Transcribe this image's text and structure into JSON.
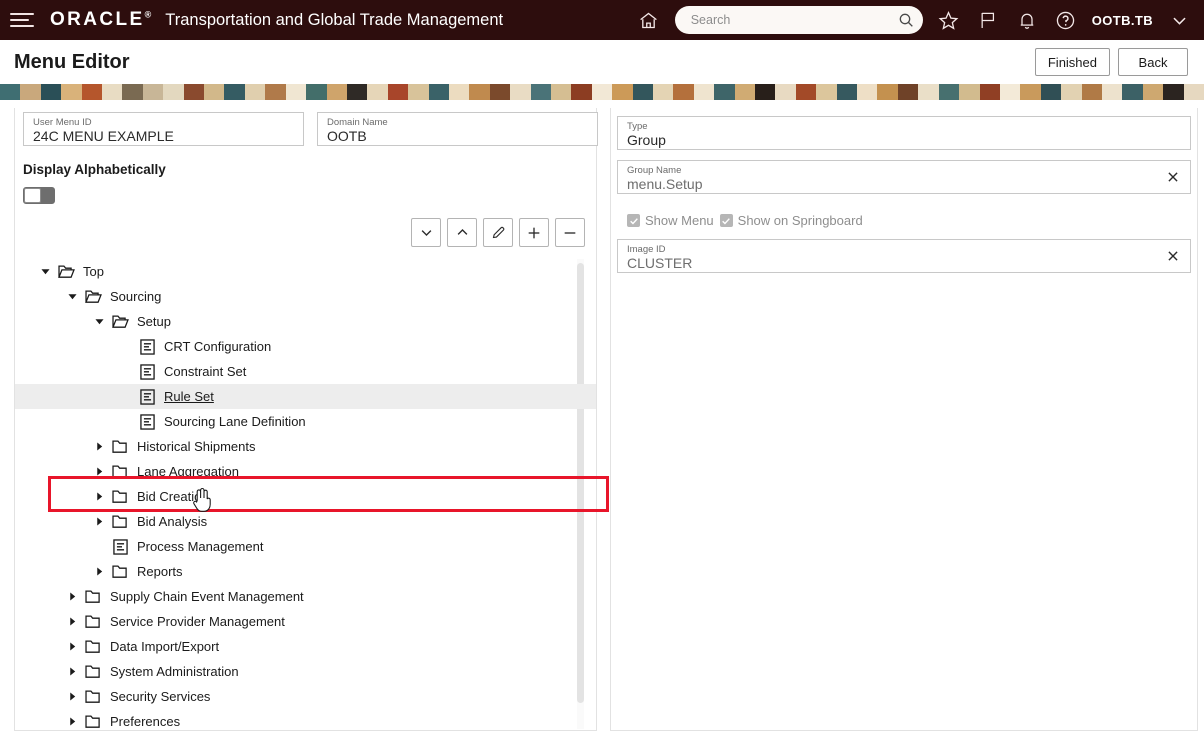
{
  "header": {
    "menu_icon": "hamburger-icon",
    "brand": "ORACLE",
    "brand_trademark": "®",
    "app_title": "Transportation and Global Trade Management",
    "home_icon": "home-icon",
    "search": {
      "value": "",
      "placeholder": "Search",
      "icon": "search-icon"
    },
    "icons": [
      "star-icon",
      "flag-icon",
      "bell-icon",
      "help-icon"
    ],
    "user": "OOTB.TB",
    "user_chevron": "chevron-down-icon"
  },
  "page": {
    "title": "Menu Editor",
    "actions": [
      {
        "label": "Finished",
        "name": "finished-button"
      },
      {
        "label": "Back",
        "name": "back-button"
      }
    ]
  },
  "left": {
    "user_menu_id": {
      "label": "User Menu ID",
      "value": "24C MENU EXAMPLE"
    },
    "domain_name": {
      "label": "Domain Name",
      "value": "OOTB"
    },
    "display_alphabetically_label": "Display Alphabetically",
    "display_alphabetically_on": false,
    "toolbar": [
      {
        "name": "move-down-button",
        "icon": "chevron-down-icon"
      },
      {
        "name": "move-up-button",
        "icon": "chevron-up-icon"
      },
      {
        "name": "edit-button",
        "icon": "pencil-icon"
      },
      {
        "name": "add-button",
        "icon": "plus-icon"
      },
      {
        "name": "remove-button",
        "icon": "minus-icon"
      }
    ],
    "tree": [
      {
        "label": "Top",
        "depth": 0,
        "kind": "folder",
        "state": "expanded"
      },
      {
        "label": "Sourcing",
        "depth": 1,
        "kind": "folder",
        "state": "expanded"
      },
      {
        "label": "Setup",
        "depth": 2,
        "kind": "folder",
        "state": "expanded"
      },
      {
        "label": "CRT Configuration",
        "depth": 3,
        "kind": "page",
        "state": "leaf"
      },
      {
        "label": "Constraint Set",
        "depth": 3,
        "kind": "page",
        "state": "leaf"
      },
      {
        "label": "Rule Set",
        "depth": 3,
        "kind": "page",
        "state": "leaf",
        "selected": true
      },
      {
        "label": "Sourcing Lane Definition",
        "depth": 3,
        "kind": "page",
        "state": "leaf"
      },
      {
        "label": "Historical Shipments",
        "depth": 2,
        "kind": "folder",
        "state": "collapsed"
      },
      {
        "label": "Lane Aggregation",
        "depth": 2,
        "kind": "folder",
        "state": "collapsed"
      },
      {
        "label": "Bid Creation",
        "depth": 2,
        "kind": "folder",
        "state": "collapsed"
      },
      {
        "label": "Bid Analysis",
        "depth": 2,
        "kind": "folder",
        "state": "collapsed"
      },
      {
        "label": "Process Management",
        "depth": 2,
        "kind": "page",
        "state": "leaf"
      },
      {
        "label": "Reports",
        "depth": 2,
        "kind": "folder",
        "state": "collapsed"
      },
      {
        "label": "Supply Chain Event Management",
        "depth": 1,
        "kind": "folder",
        "state": "collapsed"
      },
      {
        "label": "Service Provider Management",
        "depth": 1,
        "kind": "folder",
        "state": "collapsed"
      },
      {
        "label": "Data Import/Export",
        "depth": 1,
        "kind": "folder",
        "state": "collapsed"
      },
      {
        "label": "System Administration",
        "depth": 1,
        "kind": "folder",
        "state": "collapsed"
      },
      {
        "label": "Security Services",
        "depth": 1,
        "kind": "folder",
        "state": "collapsed"
      },
      {
        "label": "Preferences",
        "depth": 1,
        "kind": "folder",
        "state": "collapsed"
      }
    ]
  },
  "right": {
    "type": {
      "label": "Type",
      "value": "Group"
    },
    "group_name": {
      "label": "Group Name",
      "value": "menu.Setup",
      "clear_icon": "close-icon"
    },
    "show_menu": {
      "label": "Show Menu",
      "checked": true
    },
    "show_on_springboard": {
      "label": "Show on Springboard",
      "checked": true
    },
    "image_id": {
      "label": "Image ID",
      "value": "CLUSTER",
      "clear_icon": "close-icon"
    }
  },
  "annotation": {
    "name": "red-highlight-box",
    "color": "#e8152a"
  },
  "cursor": {
    "name": "hand-cursor"
  },
  "colors": {
    "header_bg": "#2d0d0d",
    "accent_red": "#e8152a",
    "selected_row": "#ededed",
    "band": [
      "#3f6e72",
      "#c9a87c",
      "#2a4f57",
      "#d9b27a",
      "#b5562c",
      "#e8dcc3",
      "#7a6a52",
      "#c8b697",
      "#e3d8bf",
      "#8a4a2e",
      "#d2b88a",
      "#355c63",
      "#e0cfae",
      "#b07a4a",
      "#f0e6d2",
      "#436e6a",
      "#cfa46b",
      "#2f2a26",
      "#e6d6b8",
      "#a8452a",
      "#d8c39a",
      "#3a6268",
      "#ecdcc0",
      "#c08a4e",
      "#7b4a2c",
      "#e9dcc4",
      "#4a7378",
      "#d5be92",
      "#8c3d22",
      "#f2e8d6",
      "#cc9a58",
      "#33565c",
      "#e4d4b4",
      "#b4703c",
      "#efe4cf",
      "#3e6569",
      "#d0ab73",
      "#281f1a",
      "#e8dac2",
      "#a34a28",
      "#dcc69c",
      "#36595f",
      "#eedfc6",
      "#c4914f",
      "#6f4228",
      "#eadfc8",
      "#47706f",
      "#d2bb8e",
      "#903f24",
      "#f3ead8",
      "#c99a5c",
      "#304f55",
      "#e2d2b2",
      "#b07a46",
      "#ede2cd",
      "#3c6166",
      "#cea870",
      "#2b2420",
      "#e6d8c0"
    ]
  }
}
